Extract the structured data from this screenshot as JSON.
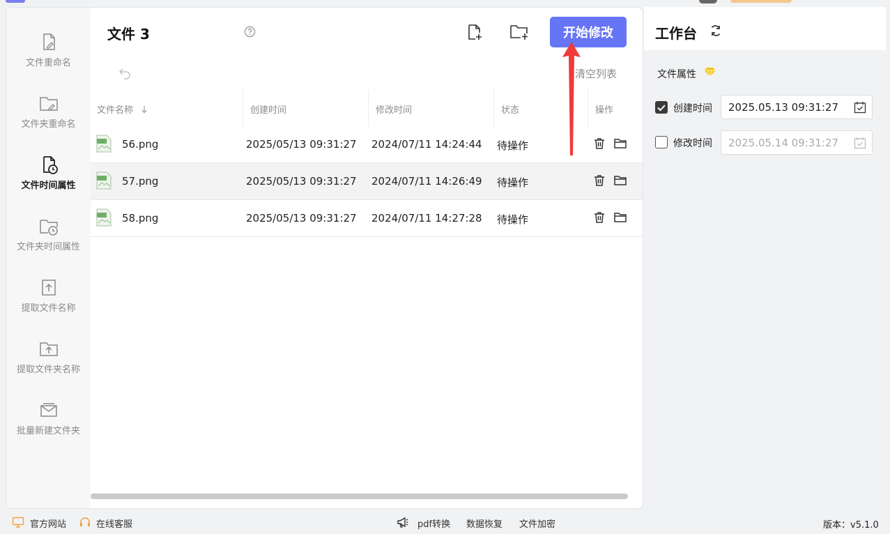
{
  "sidebar": {
    "items": [
      {
        "label": "文件重命名",
        "icon": "file-edit-icon"
      },
      {
        "label": "文件夹重命名",
        "icon": "folder-edit-icon"
      },
      {
        "label": "文件时间属性",
        "icon": "file-clock-icon",
        "active": true
      },
      {
        "label": "文件夹时间属性",
        "icon": "folder-clock-icon"
      },
      {
        "label": "提取文件名称",
        "icon": "file-upload-icon"
      },
      {
        "label": "提取文件夹名称",
        "icon": "folder-upload-icon"
      },
      {
        "label": "批量新建文件夹",
        "icon": "folder-batch-icon"
      }
    ]
  },
  "header": {
    "title": "文件 3",
    "start_button": "开始修改",
    "clear_list": "清空列表"
  },
  "table": {
    "columns": [
      "文件名称",
      "创建时间",
      "修改时间",
      "状态",
      "操作"
    ],
    "rows": [
      {
        "name": "56.png",
        "created": "2025/05/13 09:31:27",
        "modified": "2024/07/11 14:24:44",
        "status": "待操作"
      },
      {
        "name": "57.png",
        "created": "2025/05/13 09:31:27",
        "modified": "2024/07/11 14:26:49",
        "status": "待操作"
      },
      {
        "name": "58.png",
        "created": "2025/05/13 09:31:27",
        "modified": "2024/07/11 14:27:28",
        "status": "待操作"
      }
    ]
  },
  "workbench": {
    "title": "工作台",
    "attr_title": "文件属性",
    "created": {
      "label": "创建时间",
      "value": "2025.05.13 09:31:27",
      "checked": true
    },
    "modified": {
      "label": "修改时间",
      "value": "2025.05.14 09:31:27",
      "checked": false
    }
  },
  "footer": {
    "website": "官方网站",
    "support": "在线客服",
    "pdf": "pdf转换",
    "recovery": "数据恢复",
    "encrypt": "文件加密",
    "version": "版本：v5.1.0"
  },
  "colors": {
    "accent": "#6675f6",
    "arrow": "#f03a3a",
    "vip": "#f2c98d"
  }
}
